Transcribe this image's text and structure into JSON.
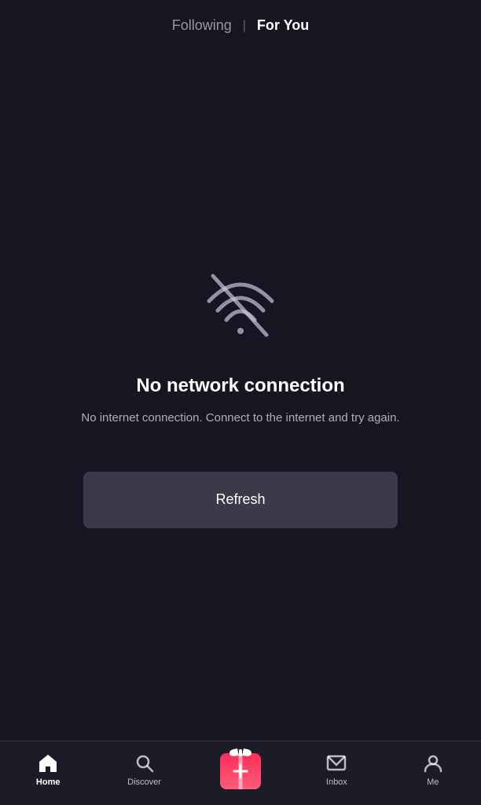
{
  "header": {
    "following_label": "Following",
    "divider": "|",
    "for_you_label": "For You",
    "active_tab": "for_you"
  },
  "error_state": {
    "title": "No network connection",
    "subtitle": "No internet connection. Connect to the internet and try again.",
    "refresh_label": "Refresh"
  },
  "bottom_nav": {
    "items": [
      {
        "id": "home",
        "label": "Home",
        "active": true
      },
      {
        "id": "discover",
        "label": "Discover",
        "active": false
      },
      {
        "id": "create",
        "label": "",
        "active": false
      },
      {
        "id": "inbox",
        "label": "Inbox",
        "active": false
      },
      {
        "id": "me",
        "label": "Me",
        "active": false
      }
    ]
  }
}
